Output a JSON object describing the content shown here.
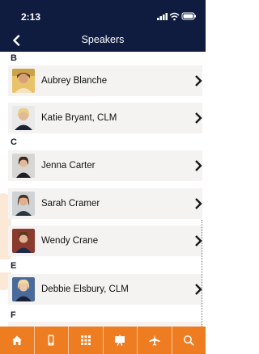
{
  "status_bar": {
    "time": "2:13",
    "icons": [
      "signal-icon",
      "wifi-icon",
      "battery-icon"
    ]
  },
  "nav": {
    "title": "Speakers",
    "back_icon": "chevron-left-icon"
  },
  "sections": [
    {
      "letter": "B",
      "speakers": [
        {
          "name": "Aubrey Blanche"
        },
        {
          "name": "Katie Bryant, CLM"
        }
      ]
    },
    {
      "letter": "C",
      "speakers": [
        {
          "name": "Jenna Carter"
        },
        {
          "name": "Sarah Cramer"
        },
        {
          "name": "Wendy Crane"
        }
      ]
    },
    {
      "letter": "E",
      "speakers": [
        {
          "name": "Debbie Elsbury, CLM"
        }
      ]
    },
    {
      "letter": "F",
      "speakers": []
    }
  ],
  "tab_bar": {
    "tabs": [
      "home-icon",
      "phone-icon",
      "grid-icon",
      "presentation-icon",
      "plane-icon",
      "search-icon"
    ]
  },
  "colors": {
    "header": "#0f1c3f",
    "tab_bar": "#ee7d22",
    "row_bg": "#f4f3f2"
  }
}
